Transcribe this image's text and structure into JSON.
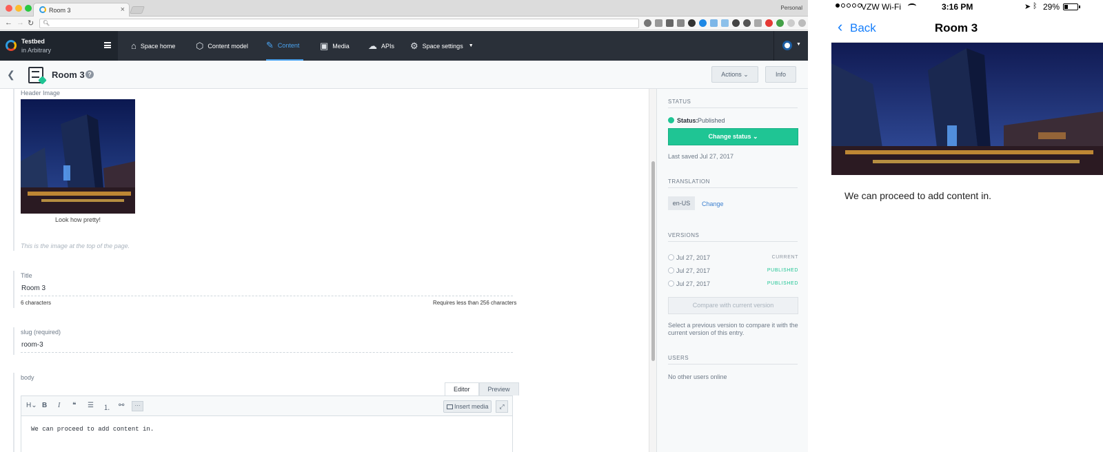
{
  "browser": {
    "tab_title": "Room 3",
    "tab_close": "×",
    "profile": "Personal",
    "url": ""
  },
  "app": {
    "space_name": "Testbed",
    "space_env": "in Arbitrary",
    "nav": [
      {
        "label": "Space home",
        "icon": "home-icon"
      },
      {
        "label": "Content model",
        "icon": "box-icon"
      },
      {
        "label": "Content",
        "icon": "edit-icon",
        "active": true
      },
      {
        "label": "Media",
        "icon": "media-icon"
      },
      {
        "label": "APIs",
        "icon": "cloud-icon"
      },
      {
        "label": "Space settings",
        "icon": "gear-icon"
      }
    ]
  },
  "entry": {
    "title": "Room 3",
    "help": "?",
    "actions_label": "Actions ⌄",
    "info_label": "Info"
  },
  "fields": {
    "header_image_label": "Header Image",
    "header_image_caption": "Look how pretty!",
    "header_image_help": "This is the image at the top of the page.",
    "title_label": "Title",
    "title_value": "Room 3",
    "title_count": "6 characters",
    "title_limit": "Requires less than 256 characters",
    "slug_label": "slug (required)",
    "slug_value": "room-3",
    "body_label": "body",
    "tab_editor": "Editor",
    "tab_preview": "Preview",
    "insert_media": "Insert media",
    "body_value": "We can proceed to add content in."
  },
  "toolbar": {
    "heading": "H⌄",
    "bold": "B",
    "italic": "I",
    "quote": "❝",
    "ul": "☰",
    "ol": "⒈",
    "link": "⚯",
    "more": "···",
    "fullscreen": "⤢"
  },
  "sidebar": {
    "status_heading": "STATUS",
    "status_label": "Status:",
    "status_value": "Published",
    "change_status": "Change status ⌄",
    "last_saved": "Last saved Jul 27, 2017",
    "translation_heading": "TRANSLATION",
    "locale": "en-US",
    "locale_change": "Change",
    "versions_heading": "VERSIONS",
    "versions": [
      {
        "date": "Jul 27, 2017",
        "tag": "CURRENT"
      },
      {
        "date": "Jul 27, 2017",
        "tag": "PUBLISHED"
      },
      {
        "date": "Jul 27, 2017",
        "tag": "PUBLISHED"
      }
    ],
    "compare_label": "Compare with current version",
    "compare_help": "Select a previous version to compare it with the current version of this entry.",
    "users_heading": "USERS",
    "users_none": "No other users online"
  },
  "phone": {
    "carrier": "VZW Wi-Fi",
    "time": "3:16 PM",
    "battery": "29%",
    "battery_level": 0.29,
    "back_label": "Back",
    "title": "Room 3",
    "body": "We can proceed to add content in."
  },
  "colors": {
    "accent": "#4aa3f0",
    "published": "#1fc594",
    "ios_blue": "#157efb",
    "header_dark": "#2a3039"
  }
}
